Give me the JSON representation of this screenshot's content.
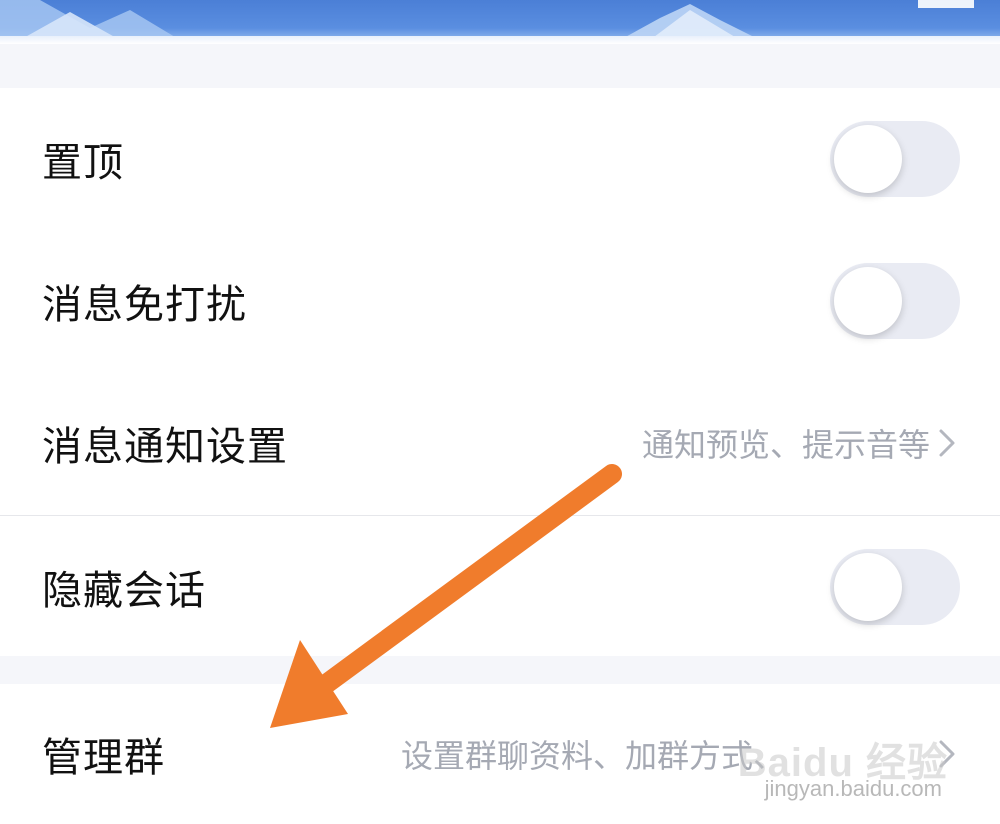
{
  "settings": {
    "pin": {
      "label": "置顶",
      "enabled": false
    },
    "mute": {
      "label": "消息免打扰",
      "enabled": false
    },
    "notify": {
      "label": "消息通知设置",
      "summary": "通知预览、提示音等"
    },
    "hide": {
      "label": "隐藏会话",
      "enabled": false
    },
    "manage": {
      "label": "管理群",
      "summary": "设置群聊资料、加群方式、"
    }
  },
  "watermark": {
    "logo": "Baidu 经验",
    "url": "jingyan.baidu.com"
  },
  "colors": {
    "accent_arrow": "#f07c2c",
    "banner": "#4b7fd6",
    "toggle_off": "#e9ebf3",
    "subtext": "#a5a9b3"
  }
}
